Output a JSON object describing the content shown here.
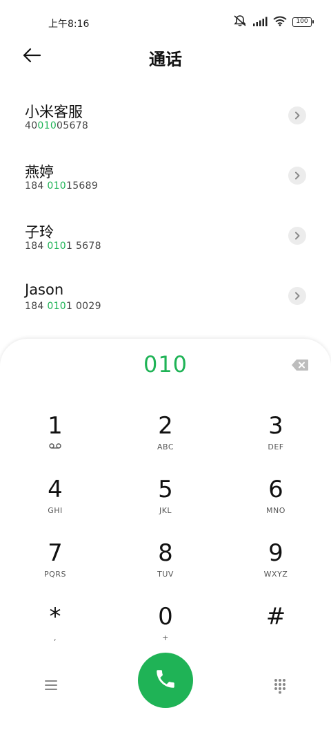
{
  "status_bar": {
    "time": "上午8:16",
    "battery": "100"
  },
  "header": {
    "title": "通话"
  },
  "contacts": [
    {
      "name": "小米客服",
      "number_pre": "40",
      "number_match": "010",
      "number_post": "05678"
    },
    {
      "name": "燕婷",
      "number_pre": "184 ",
      "number_match": "010",
      "number_post": "15689"
    },
    {
      "name": "子玲",
      "number_pre": "184 ",
      "number_match": "010",
      "number_post": "1 5678"
    },
    {
      "name": "Jason",
      "number_pre": "184 ",
      "number_match": "010",
      "number_post": "1 0029"
    }
  ],
  "dialpad": {
    "input": "010",
    "keys": [
      {
        "digit": "1",
        "letters": ""
      },
      {
        "digit": "2",
        "letters": "ABC"
      },
      {
        "digit": "3",
        "letters": "DEF"
      },
      {
        "digit": "4",
        "letters": "GHI"
      },
      {
        "digit": "5",
        "letters": "JKL"
      },
      {
        "digit": "6",
        "letters": "MNO"
      },
      {
        "digit": "7",
        "letters": "PQRS"
      },
      {
        "digit": "8",
        "letters": "TUV"
      },
      {
        "digit": "9",
        "letters": "WXYZ"
      },
      {
        "digit": "*",
        "letters": ","
      },
      {
        "digit": "0",
        "letters": "+"
      },
      {
        "digit": "#",
        "letters": ""
      }
    ]
  },
  "colors": {
    "accent": "#1fb356",
    "text": "#111111",
    "secondary_text": "#444444",
    "detail_button_bg": "#ececec"
  },
  "icons": {
    "back": "arrow-left-icon",
    "detail": "chevron-right-icon",
    "delete": "backspace-icon",
    "voicemail": "voicemail-icon",
    "menu": "menu-icon",
    "call": "phone-icon",
    "keypad": "dialpad-grid-icon"
  }
}
